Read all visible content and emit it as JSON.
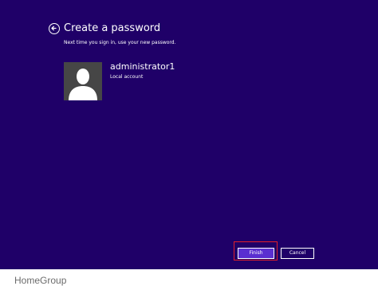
{
  "wizard": {
    "title": "Create a password",
    "subtitle": "Next time you sign in, use your new password.",
    "back_icon": "back-arrow-icon"
  },
  "account": {
    "username": "administrator1",
    "type": "Local account",
    "avatar_icon": "user-silhouette-icon"
  },
  "buttons": {
    "finish_label": "Finish",
    "cancel_label": "Cancel"
  },
  "footer": {
    "label": "HomeGroup"
  },
  "colors": {
    "background": "#1f0068",
    "finish_button": "#5a2fd0",
    "highlight_outline": "#e0202a"
  }
}
